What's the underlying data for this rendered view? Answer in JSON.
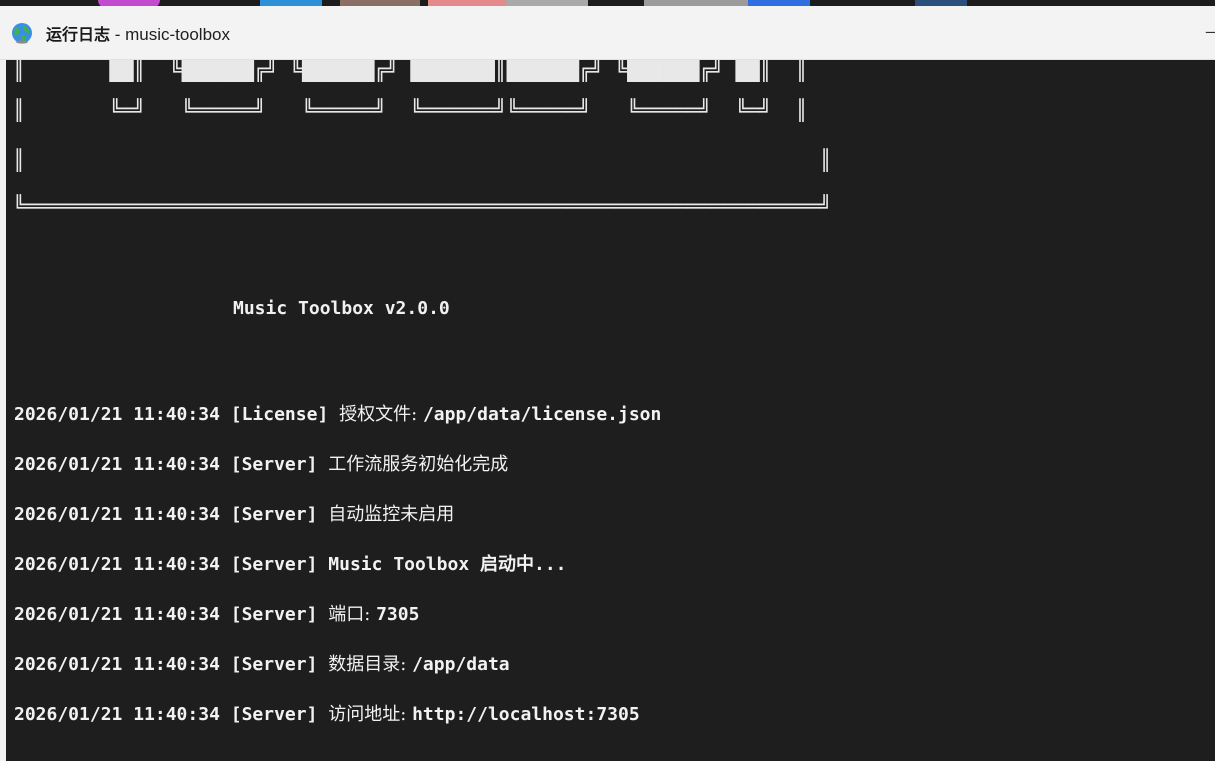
{
  "window": {
    "title_strong": "运行日志",
    "title_rest": " - music-toolbox",
    "minimize_glyph": "—"
  },
  "icons": {
    "app": "globe-icon"
  },
  "banner": {
    "row1": "║       ██║  ╚██████╔╝ ╚██████╔╝ ███████║██████╔╝ ╚██████╔╝ ██║  ║",
    "row2": "║       ╚═╝   ╚═════╝   ╚═════╝  ╚══════╝╚═════╝   ╚═════╝  ╚═╝  ║",
    "row3": "║                                                                  ║",
    "row4": "╚══════════════════════════════════════════════════════════════════╝",
    "version": "Music Toolbox v2.0.0"
  },
  "logs": [
    {
      "ts": "2026/01/21 11:40:34",
      "tag": "[License]",
      "msg": "授权文件: ",
      "val": "/app/data/license.json"
    },
    {
      "ts": "2026/01/21 11:40:34",
      "tag": "[Server]",
      "msg": "工作流服务初始化完成",
      "val": ""
    },
    {
      "ts": "2026/01/21 11:40:34",
      "tag": "[Server]",
      "msg": "自动监控未启用",
      "val": ""
    },
    {
      "ts": "2026/01/21 11:40:34",
      "tag": "[Server]",
      "msg": "",
      "val": "Music Toolbox 启动中..."
    },
    {
      "ts": "2026/01/21 11:40:34",
      "tag": "[Server]",
      "msg": "端口: ",
      "val": "7305"
    },
    {
      "ts": "2026/01/21 11:40:34",
      "tag": "[Server]",
      "msg": "数据目录: ",
      "val": "/app/data"
    },
    {
      "ts": "2026/01/21 11:40:34",
      "tag": "[Server]",
      "msg": "访问地址: ",
      "val": "http://localhost:7305"
    }
  ],
  "colors": {
    "console_bg": "#1e1e1e",
    "titlebar_bg": "#f3f3f3",
    "text": "#f2f2f2"
  }
}
